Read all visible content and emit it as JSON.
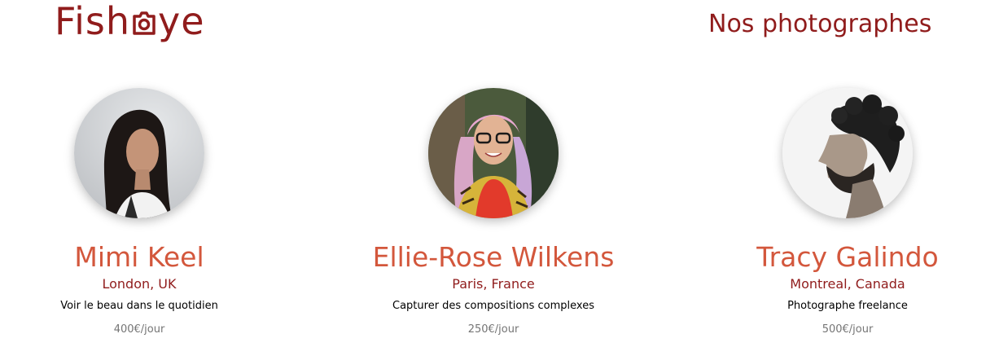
{
  "header": {
    "logo_left": "Fish",
    "logo_right": "ye",
    "logo_icon": "camera-icon",
    "title": "Nos photographes"
  },
  "colors": {
    "brand": "#901C1C",
    "name": "#D3573C",
    "price": "#757575"
  },
  "photographers": [
    {
      "name": "Mimi Keel",
      "location": "London, UK",
      "tagline": "Voir le beau dans le quotidien",
      "price": "400€/jour"
    },
    {
      "name": "Ellie-Rose Wilkens",
      "location": "Paris, France",
      "tagline": "Capturer des compositions complexes",
      "price": "250€/jour"
    },
    {
      "name": "Tracy Galindo",
      "location": "Montreal, Canada",
      "tagline": "Photographe freelance",
      "price": "500€/jour"
    }
  ]
}
